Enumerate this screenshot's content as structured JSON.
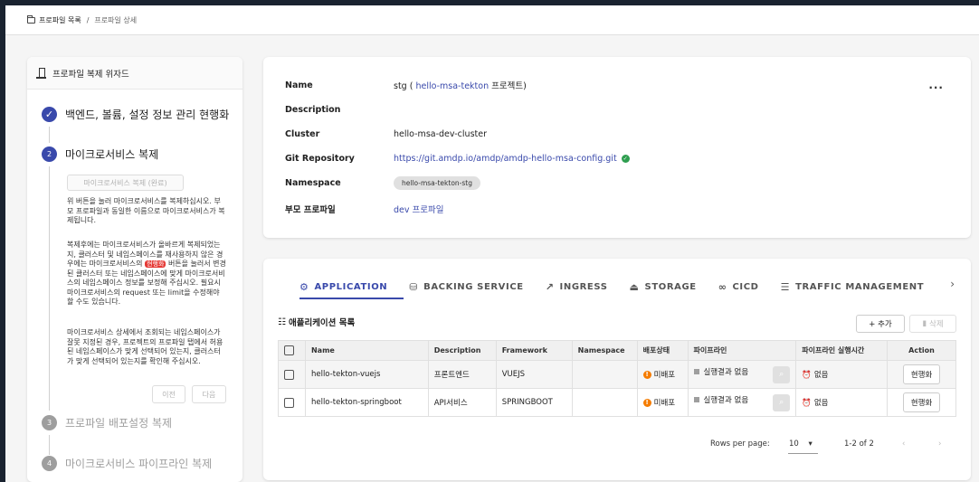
{
  "breadcrumb": {
    "root": "프로파일 목록",
    "separator": "/",
    "current": "프로파일 상세"
  },
  "wizard": {
    "title": "프로파일 복제 위자드",
    "steps": [
      {
        "label": "백엔드, 볼륨, 설정 정보 관리 현행화",
        "state": "done"
      },
      {
        "number": "2",
        "label": "마이크로서비스 복제",
        "state": "active"
      },
      {
        "number": "3",
        "label": "프로파일 배포설정 복제",
        "state": "pending"
      },
      {
        "number": "4",
        "label": "마이크로서비스 파이프라인 복제",
        "state": "pending"
      }
    ],
    "duplicate_button": "마이크로서비스 복제 (완료)",
    "para1": "위 버튼을 눌러 마이크로서비스를 복제하십시오. 부모 프로파일과 동일한 이름으로 마이크로서비스가 복제됩니다.",
    "para2_a": "복제후에는 마이크로서비스가 올바르게 복제되었는지, 클러스터 및 네임스페이스를 재사용하지 않은 경우에는 마이크로서비스의",
    "para2_badge": "현행화",
    "para2_b": "버튼을 눌러서 변경된 클러스터 또는 네임스페이스에 맞게 마이크로서비스의 네임스페이스 정보를 보정해 주십시오. 필요시 마이크로서비스의 request 또는 limit을 수정해야 할 수도 있습니다.",
    "para3": "마이크로서비스 상세에서 조회되는 네임스페이스가 잘못 지정된 경우, 프로젝트의 프로파일 탭에서 허용된 네임스페이스가 맞게 선택되어 있는지, 클러스터가 맞게 선택되어 있는지를 확인해 주십시오.",
    "prev_button": "이전",
    "next_button": "다음"
  },
  "profile": {
    "name_label": "Name",
    "name_prefix": "stg (",
    "name_link": "hello-msa-tekton",
    "name_suffix": "프로젝트)",
    "description_label": "Description",
    "description_value": "",
    "cluster_label": "Cluster",
    "cluster_value": "hello-msa-dev-cluster",
    "git_label": "Git Repository",
    "git_value": "https://git.amdp.io/amdp/amdp-hello-msa-config.git",
    "namespace_label": "Namespace",
    "namespace_value": "hello-msa-tekton-stg",
    "parent_label": "부모 프로파일",
    "parent_value": "dev 프로파일",
    "more": "..."
  },
  "tabs": [
    {
      "label": "APPLICATION",
      "icon": "⚙"
    },
    {
      "label": "BACKING SERVICE",
      "icon": "⛁"
    },
    {
      "label": "INGRESS",
      "icon": "↗"
    },
    {
      "label": "STORAGE",
      "icon": "⏏"
    },
    {
      "label": "CICD",
      "icon": "∞"
    },
    {
      "label": "TRAFFIC MANAGEMENT",
      "icon": "☰"
    }
  ],
  "app_list": {
    "title": "애플리케이션 목록",
    "add_button": "+ 추가",
    "delete_button": "삭제",
    "columns": [
      "Name",
      "Description",
      "Framework",
      "Namespace",
      "배포상태",
      "파이프라인",
      "파이프라인 실행시간",
      "Action"
    ],
    "rows": [
      {
        "name": "hello-tekton-vuejs",
        "description": "프론트엔드",
        "framework": "VUEJS",
        "namespace": "",
        "deploy": "미배포",
        "pipeline": "실행결과 없음",
        "runtime": "없음",
        "action": "현행화"
      },
      {
        "name": "hello-tekton-springboot",
        "description": "API서비스",
        "framework": "SPRINGBOOT",
        "namespace": "",
        "deploy": "미배포",
        "pipeline": "실행결과 없음",
        "runtime": "없음",
        "action": "현행화"
      }
    ],
    "rows_per_page_label": "Rows per page:",
    "rows_per_page_value": "10",
    "range": "1-2 of 2"
  }
}
